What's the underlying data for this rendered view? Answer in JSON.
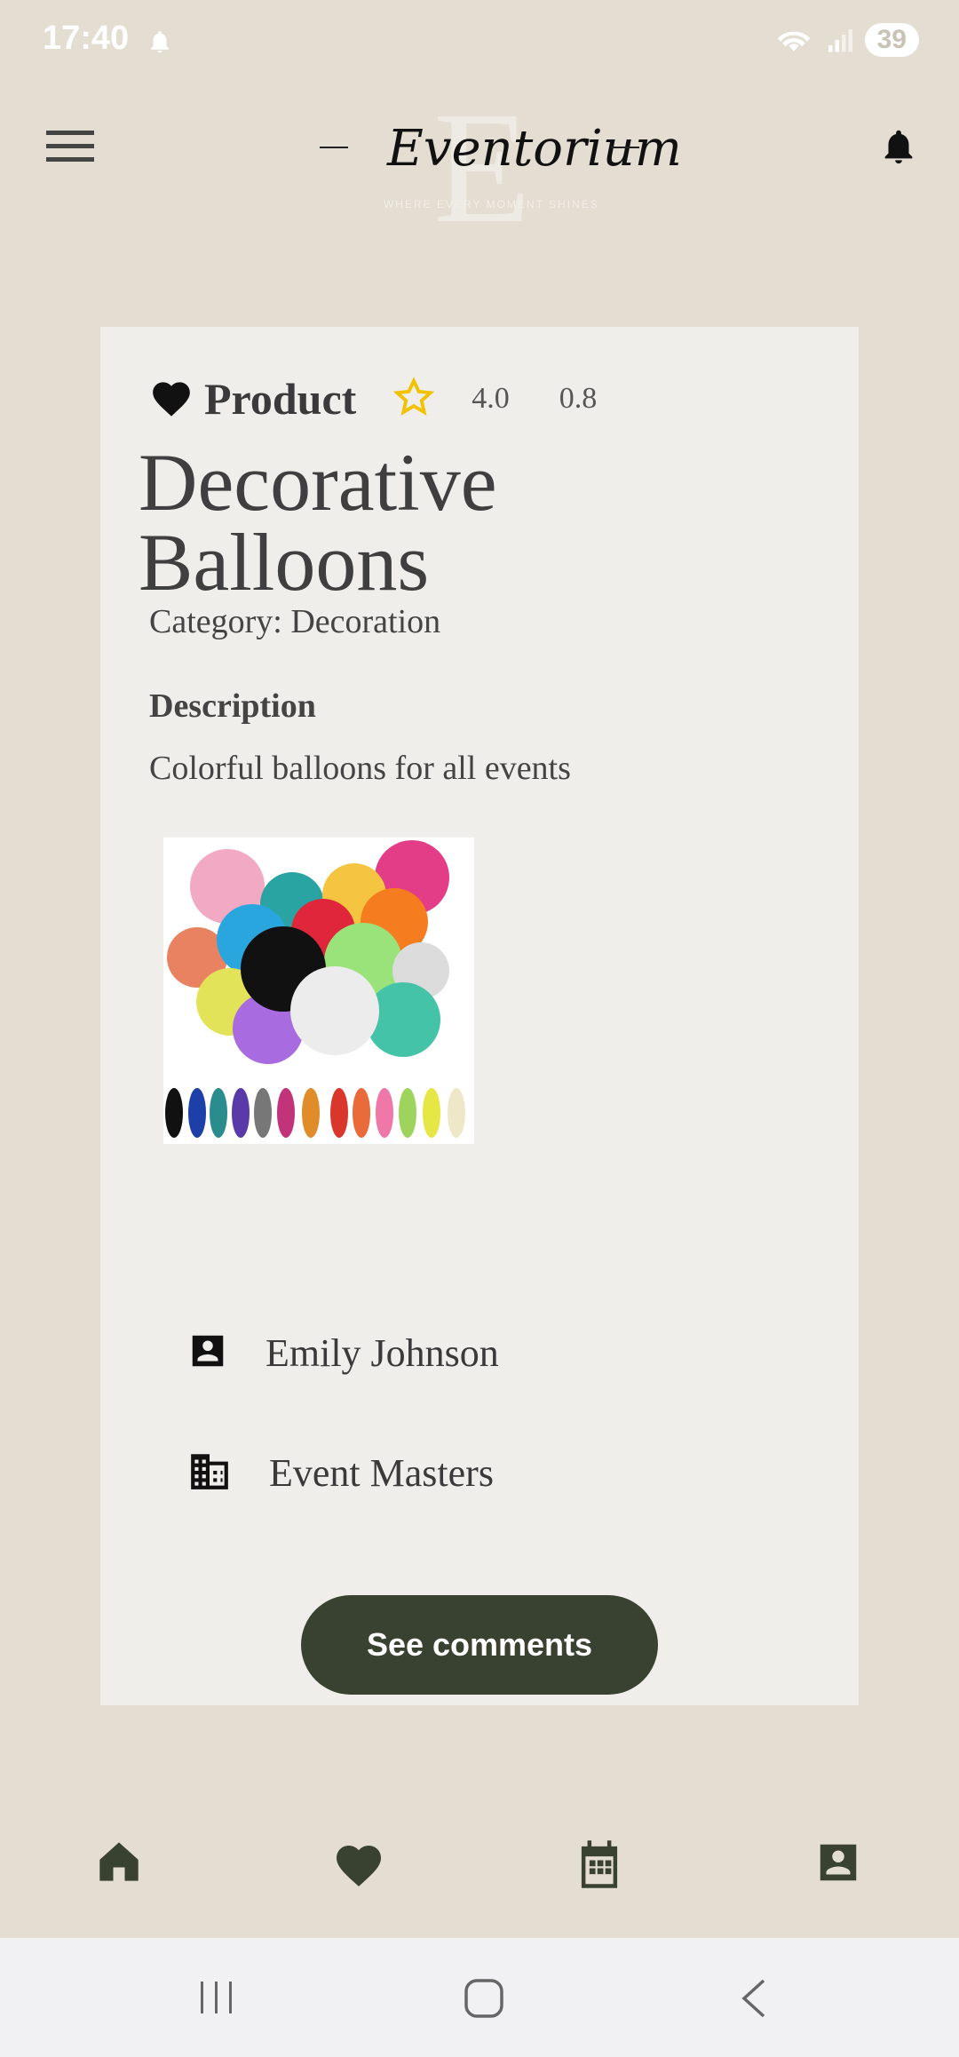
{
  "status_bar": {
    "time": "17:40",
    "battery": "39"
  },
  "app_bar": {
    "logo_title": "Eventorium",
    "logo_initial": "E",
    "logo_tagline": "WHERE EVERY MOMENT SHINES"
  },
  "product": {
    "label": "Product",
    "rating": "4.0",
    "price": "0.8",
    "name": "Decorative Balloons",
    "category": "Category: Decoration",
    "description_label": "Description",
    "description": "Colorful balloons for all events",
    "provider_name": "Emily Johnson",
    "company_name": "Event Masters",
    "see_comments_label": "See comments"
  },
  "icons": [
    "menu-icon",
    "bell-icon",
    "heart-icon",
    "star-outline-icon",
    "contact-card-icon",
    "building-icon",
    "home-icon",
    "calendar-icon",
    "account-box-icon"
  ],
  "colors": {
    "background": "#e3ddd2",
    "card": "#f0eeea",
    "accent": "#394130",
    "star": "#f2c200"
  }
}
